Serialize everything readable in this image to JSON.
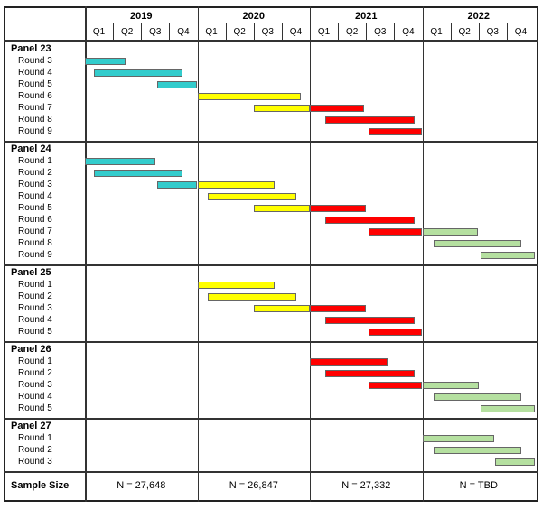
{
  "chart_data": {
    "type": "bar",
    "subtype": "gantt",
    "years": [
      "2019",
      "2020",
      "2021",
      "2022"
    ],
    "quarters": [
      "Q1",
      "Q2",
      "Q3",
      "Q4"
    ],
    "x_range": [
      2019.0,
      2023.0
    ],
    "colors": {
      "2019": "#33cccc",
      "2020": "#ffff00",
      "2021": "#ff0000",
      "2022": "#b5e0a0"
    },
    "panels": [
      {
        "title": "Panel 23",
        "rounds": [
          {
            "label": "Round 3",
            "segments": [
              [
                2019.0,
                2019.36,
                "2019"
              ]
            ]
          },
          {
            "label": "Round 4",
            "segments": [
              [
                2019.08,
                2019.87,
                "2019"
              ]
            ]
          },
          {
            "label": "Round 5",
            "segments": [
              [
                2019.64,
                2020.0,
                "2019"
              ]
            ]
          },
          {
            "label": "Round 6",
            "segments": [
              [
                2020.0,
                2020.92,
                "2020"
              ]
            ]
          },
          {
            "label": "Round 7",
            "segments": [
              [
                2020.5,
                2021.0,
                "2020"
              ],
              [
                2021.0,
                2021.48,
                "2021"
              ]
            ]
          },
          {
            "label": "Round 8",
            "segments": [
              [
                2021.14,
                2021.93,
                "2021"
              ]
            ]
          },
          {
            "label": "Round 9",
            "segments": [
              [
                2021.52,
                2022.0,
                "2021"
              ]
            ]
          }
        ]
      },
      {
        "title": "Panel 24",
        "rounds": [
          {
            "label": "Round 1",
            "segments": [
              [
                2019.0,
                2019.63,
                "2019"
              ]
            ]
          },
          {
            "label": "Round 2",
            "segments": [
              [
                2019.08,
                2019.87,
                "2019"
              ]
            ]
          },
          {
            "label": "Round 3",
            "segments": [
              [
                2019.64,
                2020.0,
                "2019"
              ],
              [
                2020.0,
                2020.69,
                "2020"
              ]
            ]
          },
          {
            "label": "Round 4",
            "segments": [
              [
                2020.09,
                2020.88,
                "2020"
              ]
            ]
          },
          {
            "label": "Round 5",
            "segments": [
              [
                2020.5,
                2021.0,
                "2020"
              ],
              [
                2021.0,
                2021.5,
                "2021"
              ]
            ]
          },
          {
            "label": "Round 6",
            "segments": [
              [
                2021.14,
                2021.93,
                "2021"
              ]
            ]
          },
          {
            "label": "Round 7",
            "segments": [
              [
                2021.52,
                2022.0,
                "2021"
              ],
              [
                2022.0,
                2022.49,
                "2022"
              ]
            ]
          },
          {
            "label": "Round 8",
            "segments": [
              [
                2022.1,
                2022.88,
                "2022"
              ]
            ]
          },
          {
            "label": "Round 9",
            "segments": [
              [
                2022.52,
                2023.0,
                "2022"
              ]
            ]
          }
        ]
      },
      {
        "title": "Panel 25",
        "rounds": [
          {
            "label": "Round 1",
            "segments": [
              [
                2020.0,
                2020.69,
                "2020"
              ]
            ]
          },
          {
            "label": "Round 2",
            "segments": [
              [
                2020.09,
                2020.88,
                "2020"
              ]
            ]
          },
          {
            "label": "Round 3",
            "segments": [
              [
                2020.5,
                2021.0,
                "2020"
              ],
              [
                2021.0,
                2021.5,
                "2021"
              ]
            ]
          },
          {
            "label": "Round 4",
            "segments": [
              [
                2021.14,
                2021.93,
                "2021"
              ]
            ]
          },
          {
            "label": "Round 5",
            "segments": [
              [
                2021.52,
                2022.0,
                "2021"
              ]
            ]
          }
        ]
      },
      {
        "title": "Panel 26",
        "rounds": [
          {
            "label": "Round 1",
            "segments": [
              [
                2021.0,
                2021.69,
                "2021"
              ]
            ]
          },
          {
            "label": "Round 2",
            "segments": [
              [
                2021.14,
                2021.93,
                "2021"
              ]
            ]
          },
          {
            "label": "Round 3",
            "segments": [
              [
                2021.52,
                2022.0,
                "2021"
              ],
              [
                2022.0,
                2022.5,
                "2022"
              ]
            ]
          },
          {
            "label": "Round 4",
            "segments": [
              [
                2022.1,
                2022.88,
                "2022"
              ]
            ]
          },
          {
            "label": "Round 5",
            "segments": [
              [
                2022.52,
                2023.0,
                "2022"
              ]
            ]
          }
        ]
      },
      {
        "title": "Panel 27",
        "rounds": [
          {
            "label": "Round 1",
            "segments": [
              [
                2022.0,
                2022.64,
                "2022"
              ]
            ]
          },
          {
            "label": "Round 2",
            "segments": [
              [
                2022.1,
                2022.88,
                "2022"
              ]
            ]
          },
          {
            "label": "Round 3",
            "segments": [
              [
                2022.65,
                2023.0,
                "2022"
              ]
            ]
          }
        ]
      }
    ],
    "sample_size": {
      "label": "Sample Size",
      "values": [
        "N = 27,648",
        "N = 26,847",
        "N = 27,332",
        "N = TBD"
      ]
    }
  }
}
